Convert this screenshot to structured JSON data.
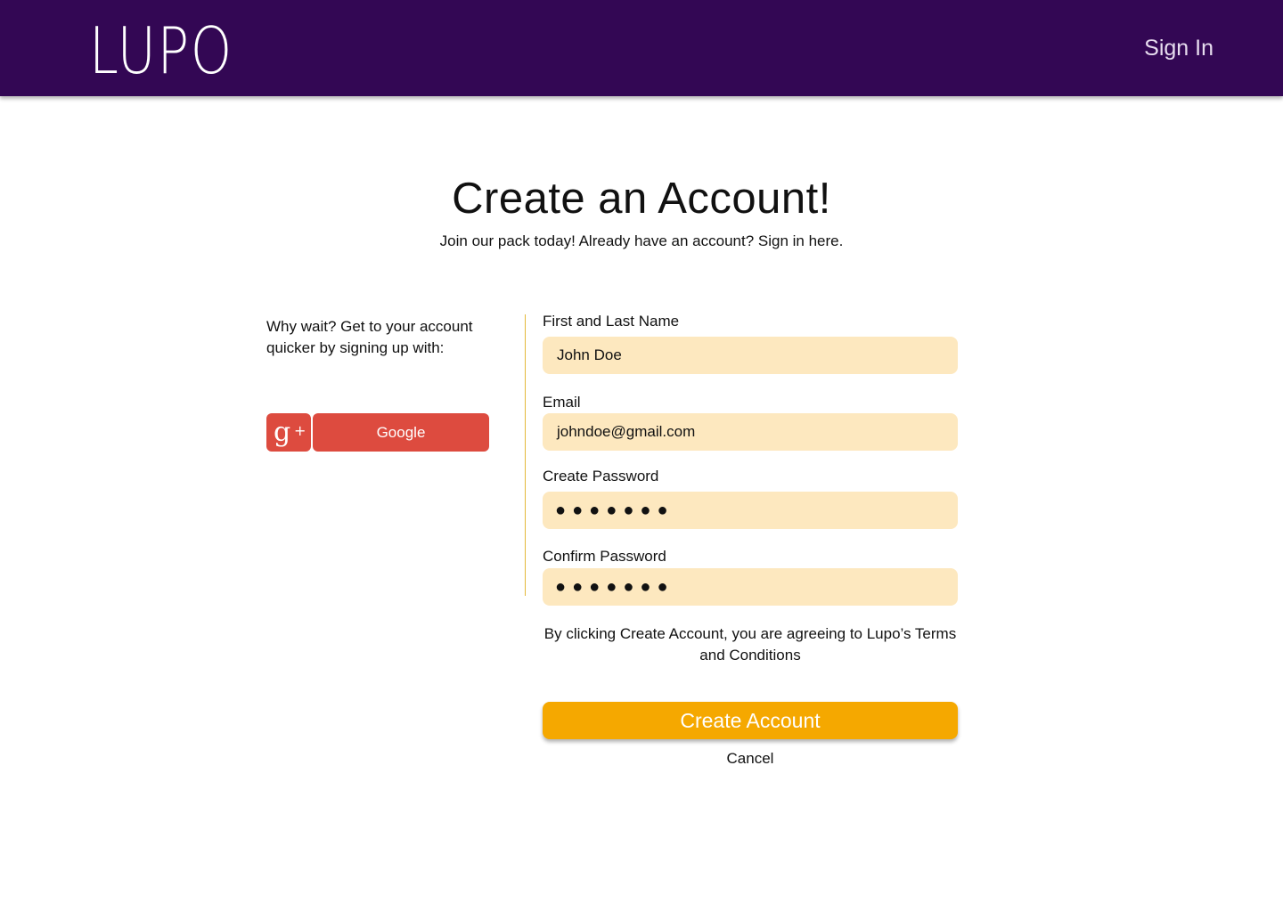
{
  "header": {
    "logo": "LUPO",
    "sign_in": "Sign In"
  },
  "main": {
    "title": "Create an Account!",
    "subtitle": "Join our pack today! Already have an account? Sign in here."
  },
  "social": {
    "prompt": "Why wait? Get to your account quicker by signing up with:",
    "google_label": "Google",
    "icon": "google-plus-icon"
  },
  "form": {
    "name_label": "First and Last Name",
    "name_value": "John Doe",
    "email_label": "Email",
    "email_value": "johndoe@gmail.com",
    "password_label": "Create Password",
    "password_value": "●●●●●●●",
    "confirm_label": "Confirm Password",
    "confirm_value": "●●●●●●●",
    "terms": "By clicking Create Account, you are agreeing to Lupo’s Terms and Conditions",
    "create_label": "Create Account",
    "cancel_label": "Cancel"
  },
  "colors": {
    "header_bg": "#330754",
    "field_bg": "#fde8bf",
    "primary": "#f5a800",
    "google": "#dd4b3f",
    "divider": "#e3b83a"
  }
}
